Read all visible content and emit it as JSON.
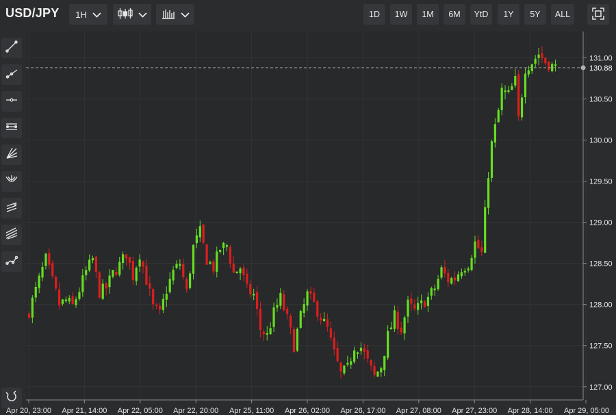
{
  "header": {
    "symbol": "USD/JPY",
    "interval_label": "1H",
    "chart_type_icon": "candlestick-icon",
    "indicator_icon": "bar-chart-icon",
    "ranges": [
      "1D",
      "1W",
      "1M",
      "6M",
      "YtD",
      "1Y",
      "5Y",
      "ALL"
    ],
    "fullscreen_icon": "fullscreen-icon"
  },
  "sidebar": {
    "tools": [
      "trend-line-icon",
      "ray-line-icon",
      "horizontal-line-icon",
      "parallel-channel-icon",
      "fan-icon",
      "pitchfork-icon",
      "regression-channel-icon",
      "multi-line-icon",
      "path-icon"
    ],
    "bottom_tool": "magnet-icon"
  },
  "colors": {
    "background": "#2b2c2e",
    "plot_background": "#28292b",
    "up": "#66dd22",
    "down": "#dd1e1e",
    "grid": "#333436",
    "axis_text": "#e6e6e6"
  },
  "chart_data": {
    "type": "candlestick",
    "title": "",
    "xlabel": "",
    "ylabel": "",
    "ylim": [
      126.84,
      131.32
    ],
    "grid": true,
    "last_price_label": "130.88",
    "y_ticks": [
      "127.00",
      "127.50",
      "128.00",
      "128.50",
      "129.00",
      "129.50",
      "130.00",
      "130.50",
      "131.00"
    ],
    "x_ticks": [
      "Apr 20, 23:00",
      "Apr 21, 14:00",
      "Apr 22, 05:00",
      "Apr 22, 20:00",
      "Apr 25, 11:00",
      "Apr 26, 02:00",
      "Apr 26, 17:00",
      "Apr 27, 08:00",
      "Apr 27, 23:00",
      "Apr 28, 14:00",
      "Apr 29, 05:00"
    ],
    "close_path": [
      [
        0,
        127.92
      ],
      [
        3,
        128.3
      ],
      [
        5,
        128.55
      ],
      [
        7,
        128.28
      ],
      [
        9,
        128.0
      ],
      [
        11,
        128.05
      ],
      [
        13,
        127.98
      ],
      [
        15,
        128.18
      ],
      [
        17,
        128.4
      ],
      [
        19,
        128.55
      ],
      [
        21,
        128.15
      ],
      [
        23,
        128.2
      ],
      [
        25,
        128.38
      ],
      [
        27,
        128.48
      ],
      [
        29,
        128.62
      ],
      [
        31,
        128.35
      ],
      [
        33,
        128.62
      ],
      [
        35,
        128.3
      ],
      [
        37,
        127.96
      ],
      [
        39,
        127.88
      ],
      [
        41,
        128.18
      ],
      [
        43,
        128.4
      ],
      [
        45,
        128.5
      ],
      [
        47,
        128.15
      ],
      [
        49,
        128.7
      ],
      [
        51,
        128.88
      ],
      [
        53,
        128.55
      ],
      [
        55,
        128.45
      ],
      [
        57,
        128.68
      ],
      [
        59,
        128.72
      ],
      [
        61,
        128.38
      ],
      [
        63,
        128.45
      ],
      [
        65,
        128.18
      ],
      [
        67,
        128.12
      ],
      [
        69,
        127.7
      ],
      [
        71,
        127.62
      ],
      [
        73,
        127.9
      ],
      [
        75,
        128.08
      ],
      [
        77,
        127.82
      ],
      [
        79,
        127.5
      ],
      [
        81,
        127.85
      ],
      [
        83,
        128.12
      ],
      [
        85,
        128.0
      ],
      [
        87,
        127.85
      ],
      [
        89,
        127.7
      ],
      [
        91,
        127.4
      ],
      [
        93,
        127.15
      ],
      [
        95,
        127.22
      ],
      [
        97,
        127.5
      ],
      [
        99,
        127.48
      ],
      [
        101,
        127.3
      ],
      [
        103,
        127.12
      ],
      [
        105,
        127.25
      ],
      [
        107,
        127.62
      ],
      [
        109,
        127.85
      ],
      [
        111,
        127.7
      ],
      [
        113,
        128.0
      ],
      [
        115,
        127.92
      ],
      [
        117,
        128.0
      ],
      [
        119,
        128.08
      ],
      [
        121,
        128.2
      ],
      [
        123,
        128.42
      ],
      [
        125,
        128.3
      ],
      [
        127,
        128.32
      ],
      [
        129,
        128.45
      ],
      [
        131,
        128.5
      ],
      [
        133,
        128.75
      ],
      [
        135,
        128.62
      ],
      [
        137,
        129.6
      ],
      [
        138,
        129.95
      ],
      [
        140,
        130.35
      ],
      [
        141,
        130.6
      ],
      [
        143,
        130.55
      ],
      [
        145,
        130.72
      ],
      [
        146,
        130.25
      ],
      [
        148,
        130.88
      ],
      [
        150,
        130.95
      ],
      [
        152,
        131.05
      ],
      [
        154,
        130.95
      ],
      [
        156,
        130.9
      ],
      [
        157,
        130.88
      ]
    ]
  }
}
